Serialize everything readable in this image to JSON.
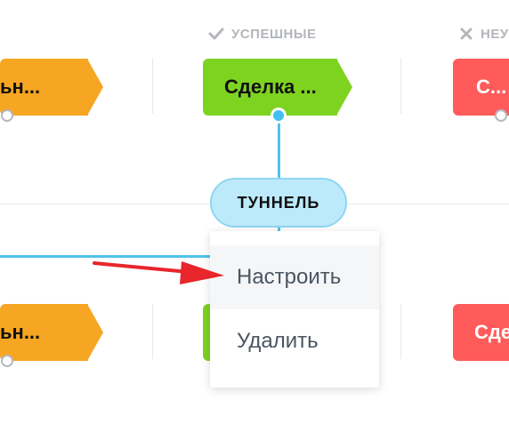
{
  "columns": {
    "success": {
      "label": "УСПЕШНЫЕ",
      "icon": "check-icon"
    },
    "failed": {
      "label": "НЕУ",
      "icon": "x-icon"
    }
  },
  "stages_row1": [
    {
      "label": "ьн...",
      "color": "#f6a623"
    },
    {
      "label": "Сделка ...",
      "color": "#7ed321"
    },
    {
      "label": "С...",
      "color": "#ff5b5b"
    }
  ],
  "stages_row2": [
    {
      "label": "ьн...",
      "color": "#f6a623"
    },
    {
      "label": "",
      "color": "#7ed321"
    },
    {
      "label": "Сде",
      "color": "#ff5b5b"
    }
  ],
  "tunnel": {
    "label": "ТУННЕЛЬ"
  },
  "context_menu": {
    "items": [
      {
        "label": "Настроить"
      },
      {
        "label": "Удалить"
      }
    ]
  },
  "colors": {
    "accent": "#41c0ef",
    "orange": "#f6a623",
    "green": "#7ed321",
    "red": "#ff5b5b",
    "annotation_arrow": "#e8262b"
  }
}
